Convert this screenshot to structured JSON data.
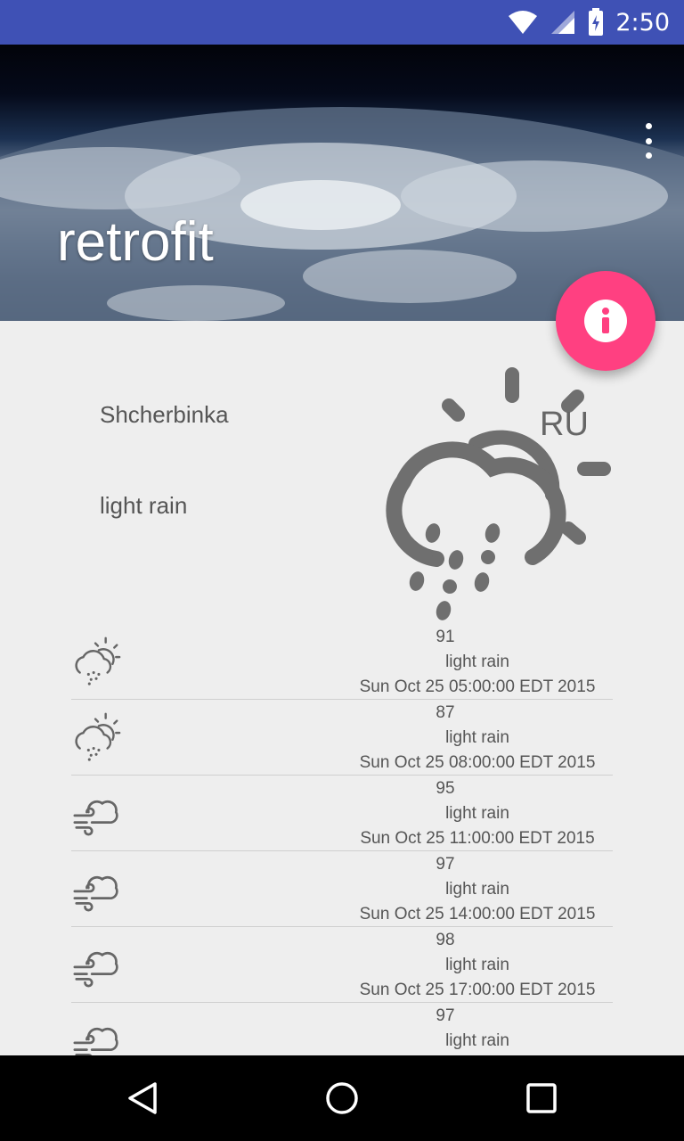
{
  "status": {
    "time": "2:50"
  },
  "app": {
    "title": "retrofit"
  },
  "current": {
    "city": "Shcherbinka",
    "country": "RU",
    "description": "light rain",
    "icon": "sun-cloud-rain-icon"
  },
  "forecast": [
    {
      "temp": "91",
      "description": "light rain",
      "date": "Sun Oct 25 05:00:00 EDT 2015",
      "icon": "sun-cloud-rain-icon"
    },
    {
      "temp": "87",
      "description": "light rain",
      "date": "Sun Oct 25 08:00:00 EDT 2015",
      "icon": "sun-cloud-rain-icon"
    },
    {
      "temp": "95",
      "description": "light rain",
      "date": "Sun Oct 25 11:00:00 EDT 2015",
      "icon": "wind-cloud-icon"
    },
    {
      "temp": "97",
      "description": "light rain",
      "date": "Sun Oct 25 14:00:00 EDT 2015",
      "icon": "wind-cloud-icon"
    },
    {
      "temp": "98",
      "description": "light rain",
      "date": "Sun Oct 25 17:00:00 EDT 2015",
      "icon": "wind-cloud-icon"
    },
    {
      "temp": "97",
      "description": "light rain",
      "date": "",
      "icon": "wind-cloud-icon"
    }
  ],
  "colors": {
    "primary": "#3f51b5",
    "accent": "#ff4081",
    "text": "#555555",
    "background": "#eeeeee"
  }
}
